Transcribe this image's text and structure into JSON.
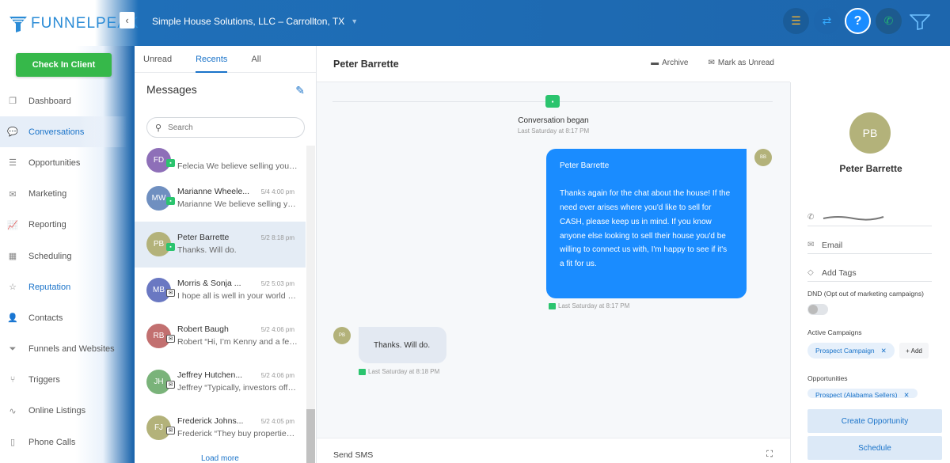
{
  "brand": {
    "logo_text": "FUNNELPEAK",
    "accent": "#1d66ad",
    "green": "#36b84a"
  },
  "header": {
    "account": "Simple House Solutions, LLC – Carrollton, TX",
    "icons": [
      "list-icon",
      "swap-icon",
      "help-icon",
      "phone-icon",
      "logo-mark-icon"
    ],
    "help_glyph": "?"
  },
  "sidebar": {
    "checkin_label": "Check In Client",
    "items": [
      {
        "label": "Dashboard",
        "icon": "dashboard-icon"
      },
      {
        "label": "Conversations",
        "icon": "chat-icon",
        "active": true
      },
      {
        "label": "Opportunities",
        "icon": "pipeline-icon"
      },
      {
        "label": "Marketing",
        "icon": "mail-icon"
      },
      {
        "label": "Reporting",
        "icon": "chart-icon"
      },
      {
        "label": "Scheduling",
        "icon": "calendar-icon"
      },
      {
        "label": "Reputation",
        "icon": "star-icon"
      },
      {
        "label": "Contacts",
        "icon": "person-icon"
      },
      {
        "label": "Funnels and Websites",
        "icon": "funnel-icon"
      },
      {
        "label": "Triggers",
        "icon": "trigger-icon"
      },
      {
        "label": "Online Listings",
        "icon": "pulse-icon"
      },
      {
        "label": "Phone Calls",
        "icon": "phone-icon"
      }
    ]
  },
  "conversations": {
    "tabs": [
      "Unread",
      "Recents",
      "All"
    ],
    "active_tab": "Recents",
    "heading": "Messages",
    "search_placeholder": "Search",
    "items": [
      {
        "initials": "FD",
        "color": "#8e6fb8",
        "name": "",
        "date": "",
        "preview": "Felecia   We believe selling your home to us is the ...",
        "channel": "sms"
      },
      {
        "initials": "MW",
        "color": "#6f8fc0",
        "name": "Marianne Wheele...",
        "date": "5/4 4:00 pm",
        "preview": "Marianne   We believe selling your home to us is ...",
        "channel": "sms"
      },
      {
        "initials": "PB",
        "color": "#b3b27a",
        "name": "Peter Barrette",
        "date": "5/2 8:18 pm",
        "preview": "Thanks. Will do.",
        "channel": "sms",
        "selected": true
      },
      {
        "initials": "MB",
        "color": "#6a78c2",
        "name": "Morris & Sonja ...",
        "date": "5/2 5:03 pm",
        "preview": "I hope all is well in your world and that you are ...",
        "channel": "mail"
      },
      {
        "initials": "RB",
        "color": "#c27070",
        "name": "Robert Baugh",
        "date": "5/2 4:06 pm",
        "preview": "Robert “Hi, I’m Kenny and a few months ago ...",
        "channel": "mail"
      },
      {
        "initials": "JH",
        "color": "#7ab37a",
        "name": "Jeffrey Hutchen...",
        "date": "5/2 4:06 pm",
        "preview": "Jeffrey “Typically, investors offer you 70% ...",
        "channel": "mail"
      },
      {
        "initials": "FJ",
        "color": "#b3b27a",
        "name": "Frederick Johns...",
        "date": "5/2 4:05 pm",
        "preview": "Frederick “They buy properties “as is” ...",
        "channel": "mail"
      }
    ],
    "load_more": "Load more"
  },
  "chat": {
    "title": "Peter Barrette",
    "archive": "Archive",
    "mark_unread": "Mark as Unread",
    "began_label": "Conversation began",
    "began_time": "Last Saturday at 8:17 PM",
    "outgoing": {
      "avatar": "BB",
      "lines": [
        "Peter Barrette",
        "",
        "Thanks again for the chat about the house! If the",
        "need ever arises where you'd like to sell for",
        "CASH, please keep us in mind.  If you know",
        "anyone else looking to sell their house you'd be",
        "willing to connect us with, I'm happy to see if it's",
        "a fit for us."
      ],
      "time": "Last Saturday at 8:17 PM"
    },
    "incoming": {
      "avatar": "PB",
      "text": "Thanks. Will do.",
      "time": "Last Saturday at 8:18 PM"
    },
    "composer_label": "Send SMS"
  },
  "contact": {
    "initials": "PB",
    "name": "Peter Barrette",
    "email_placeholder": "Email",
    "tags_placeholder": "Add Tags",
    "dnd_label": "DND (Opt out of marketing campaigns)",
    "dnd_on": false,
    "campaigns_label": "Active Campaigns",
    "campaign": "Prospect Campaign",
    "add_label": "+ Add",
    "opportunities_label": "Opportunities",
    "opportunity": "Prospect (Alabama Sellers)",
    "create_opportunity": "Create Opportunity",
    "schedule": "Schedule"
  }
}
